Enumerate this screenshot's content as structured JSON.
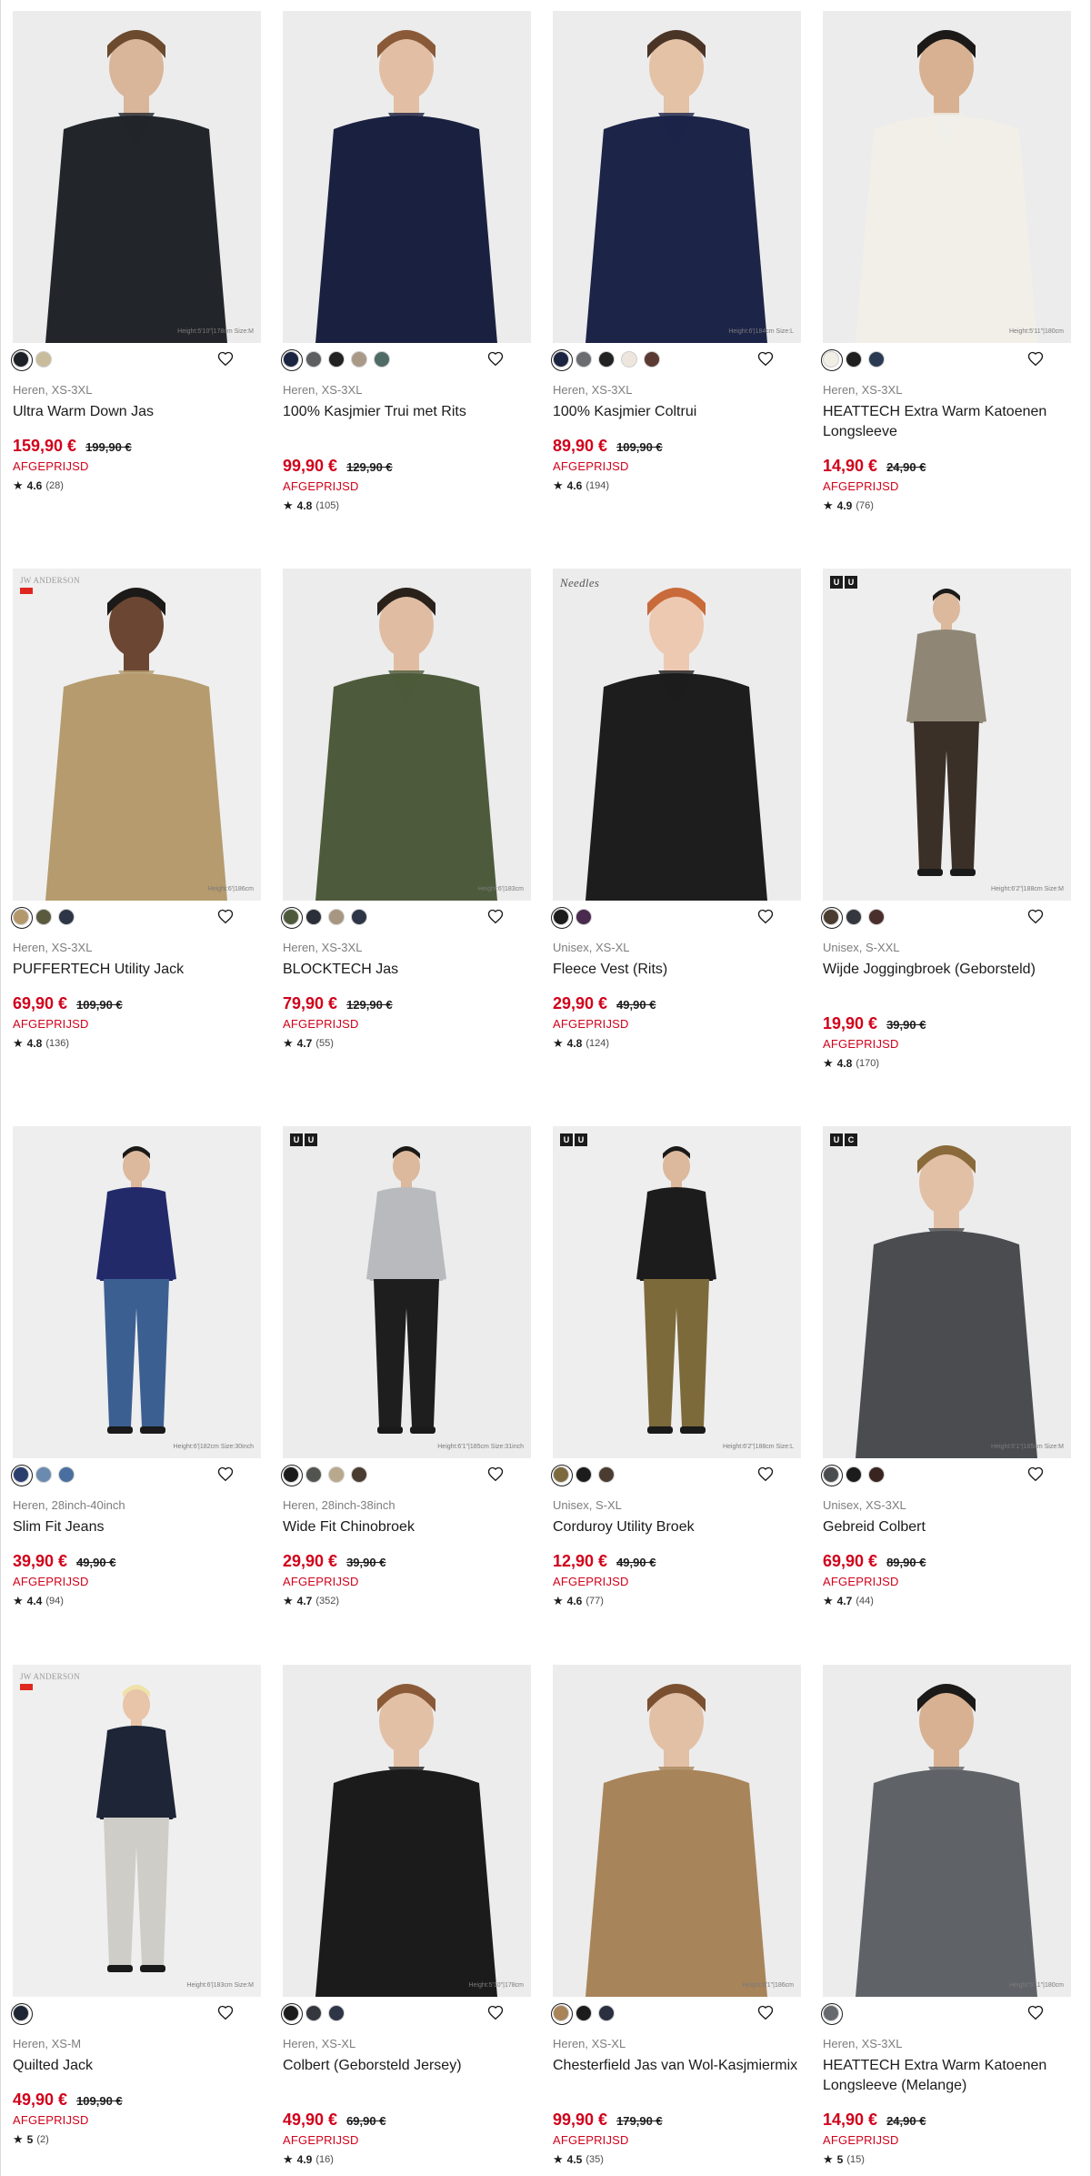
{
  "products": [
    {
      "meta": "Heren, XS-3XL",
      "name": "Ultra Warm Down Jas",
      "price": "159,90 €",
      "old_price": "199,90 €",
      "flag": "AFGEPRIJSD",
      "score": "4.6",
      "count": "(28)",
      "caption": "Height:5'10\"|178cm Size:M",
      "colors": [
        "#1d2127",
        "#c9bc9c"
      ],
      "garment": "#22262a",
      "bg": "#ececec",
      "skin": "#d9b59a",
      "hair": "#6b4a2e",
      "tag": ""
    },
    {
      "meta": "Heren, XS-3XL",
      "name": "100% Kasjmier Trui met Rits",
      "price": "99,90 €",
      "old_price": "129,90 €",
      "flag": "AFGEPRIJSD",
      "score": "4.8",
      "count": "(105)",
      "caption": "",
      "colors": [
        "#1b2440",
        "#5d5f61",
        "#222222",
        "#a99a88",
        "#4f6b66"
      ],
      "garment": "#1a2140",
      "bg": "#ececec",
      "skin": "#e2bfa4",
      "hair": "#8a5a38",
      "tag": ""
    },
    {
      "meta": "Heren, XS-3XL",
      "name": "100% Kasjmier Coltrui",
      "price": "89,90 €",
      "old_price": "109,90 €",
      "flag": "AFGEPRIJSD",
      "score": "4.6",
      "count": "(194)",
      "caption": "Height:6'|184cm Size:L",
      "colors": [
        "#1b2440",
        "#6a6c70",
        "#222222",
        "#eee6dc",
        "#5a3a32"
      ],
      "garment": "#1c2448",
      "bg": "#ececec",
      "skin": "#e4c2a6",
      "hair": "#4a3426",
      "tag": ""
    },
    {
      "meta": "Heren, XS-3XL",
      "name": "HEATTECH Extra Warm Katoenen Longsleeve",
      "price": "14,90 €",
      "old_price": "24,90 €",
      "flag": "AFGEPRIJSD",
      "score": "4.9",
      "count": "(76)",
      "caption": "Height:5'11\"|180cm",
      "colors": [
        "#f1eee6",
        "#1f1f1f",
        "#2a3a52"
      ],
      "garment": "#f1efe8",
      "bg": "#ececec",
      "skin": "#d8b192",
      "hair": "#1c1a18",
      "tag": ""
    },
    {
      "meta": "Heren, XS-3XL",
      "name": "PUFFERTECH Utility Jack",
      "price": "69,90 €",
      "old_price": "109,90 €",
      "flag": "AFGEPRIJSD",
      "score": "4.8",
      "count": "(136)",
      "caption": "Height:6'|186cm",
      "colors": [
        "#b4986c",
        "#5a5b3e",
        "#2d3546"
      ],
      "garment": "#b59b6e",
      "bg": "#efefef",
      "skin": "#6b4632",
      "hair": "#1c1a18",
      "tag": "jw"
    },
    {
      "meta": "Heren, XS-3XL",
      "name": "BLOCKTECH Jas",
      "price": "79,90 €",
      "old_price": "129,90 €",
      "flag": "AFGEPRIJSD",
      "score": "4.7",
      "count": "(55)",
      "caption": "Height:6'|183cm",
      "colors": [
        "#4e5a3c",
        "#2a2f38",
        "#a79680",
        "#2d3546"
      ],
      "garment": "#4d5a3b",
      "bg": "#ececec",
      "skin": "#e0bda2",
      "hair": "#2b211b",
      "tag": ""
    },
    {
      "meta": "Unisex, XS-XL",
      "name": "Fleece Vest (Rits)",
      "price": "29,90 €",
      "old_price": "49,90 €",
      "flag": "AFGEPRIJSD",
      "score": "4.8",
      "count": "(124)",
      "caption": "",
      "colors": [
        "#1c1c1c",
        "#4a2a4e"
      ],
      "garment": "#1d1d1d",
      "bg": "#ececec",
      "skin": "#edc9b2",
      "hair": "#c96a3a",
      "tag": "needles"
    },
    {
      "meta": "Unisex, S-XXL",
      "name": "Wijde Joggingbroek (Geborsteld)",
      "price": "19,90 €",
      "old_price": "39,90 €",
      "flag": "AFGEPRIJSD",
      "score": "4.8",
      "count": "(170)",
      "caption": "Height:6'2\"|188cm Size:M",
      "colors": [
        "#4a3c30",
        "#34383e",
        "#4a2e2c"
      ],
      "garment": "#8f8676",
      "bg": "#eeeeee",
      "skin": "#dcb89c",
      "hair": "#1c1a18",
      "tag": "uu",
      "full": true,
      "pants": "#3a3028"
    },
    {
      "meta": "Heren, 28inch-40inch",
      "name": "Slim Fit Jeans",
      "price": "39,90 €",
      "old_price": "49,90 €",
      "flag": "AFGEPRIJSD",
      "score": "4.4",
      "count": "(94)",
      "caption": "Height:6'|182cm Size:30inch",
      "colors": [
        "#2a3f6e",
        "#6a8ab0",
        "#4b6ea0"
      ],
      "garment": "#232a6a",
      "bg": "#eeeeee",
      "skin": "#dcb89c",
      "hair": "#1c1a18",
      "tag": "",
      "full": true,
      "pants": "#3c5f92"
    },
    {
      "meta": "Heren, 28inch-38inch",
      "name": "Wide Fit Chinobroek",
      "price": "29,90 €",
      "old_price": "39,90 €",
      "flag": "AFGEPRIJSD",
      "score": "4.7",
      "count": "(352)",
      "caption": "Height:6'1\"|185cm Size:31inch",
      "colors": [
        "#1c1c1c",
        "#52544f",
        "#b9a98c",
        "#4a3c30"
      ],
      "garment": "#b8babe",
      "bg": "#ececec",
      "skin": "#dcb89c",
      "hair": "#1c1a18",
      "tag": "uu",
      "full": true,
      "pants": "#1e1e1e"
    },
    {
      "meta": "Unisex, S-XL",
      "name": "Corduroy Utility Broek",
      "price": "12,90 €",
      "old_price": "49,90 €",
      "flag": "AFGEPRIJSD",
      "score": "4.6",
      "count": "(77)",
      "caption": "Height:6'2\"|188cm Size:L",
      "colors": [
        "#7c6a3e",
        "#1c1c1c",
        "#4a3c30"
      ],
      "garment": "#1c1c1c",
      "bg": "#eeeeee",
      "skin": "#dcb89c",
      "hair": "#1c1a18",
      "tag": "uu",
      "full": true,
      "pants": "#7d6a3a"
    },
    {
      "meta": "Unisex, XS-3XL",
      "name": "Gebreid Colbert",
      "price": "69,90 €",
      "old_price": "89,90 €",
      "flag": "AFGEPRIJSD",
      "score": "4.7",
      "count": "(44)",
      "caption": "Height:6'1\"|185cm Size:M",
      "colors": [
        "#4a4c50",
        "#1c1c1c",
        "#3a2420"
      ],
      "garment": "#4a4c50",
      "bg": "#ececec",
      "skin": "#e2c0a6",
      "hair": "#8a6a3a",
      "tag": "uc"
    },
    {
      "meta": "Heren, XS-M",
      "name": "Quilted Jack",
      "price": "49,90 €",
      "old_price": "109,90 €",
      "flag": "AFGEPRIJSD",
      "score": "5",
      "count": "(2)",
      "caption": "Height:6'|183cm Size:M",
      "colors": [
        "#1f2633"
      ],
      "garment": "#1d2536",
      "bg": "#efefef",
      "skin": "#e8c4a8",
      "hair": "#efe2a8",
      "tag": "jw",
      "full": true,
      "pants": "#cfcdc8"
    },
    {
      "meta": "Heren, XS-XL",
      "name": "Colbert (Geborsteld Jersey)",
      "price": "49,90 €",
      "old_price": "69,90 €",
      "flag": "AFGEPRIJSD",
      "score": "4.9",
      "count": "(16)",
      "caption": "Height:5'10\"|178cm",
      "colors": [
        "#1c1c1c",
        "#34383e",
        "#2d3546"
      ],
      "garment": "#1b1b1b",
      "bg": "#ececec",
      "skin": "#e2c0a6",
      "hair": "#8a5a38",
      "tag": ""
    },
    {
      "meta": "Heren, XS-XL",
      "name": "Chesterfield Jas van Wol-Kasjmiermix",
      "price": "99,90 €",
      "old_price": "179,90 €",
      "flag": "AFGEPRIJSD",
      "score": "4.5",
      "count": "(35)",
      "caption": "Height:6'1\"|186cm",
      "colors": [
        "#a88458",
        "#1c1c1c",
        "#2a3040"
      ],
      "garment": "#a8845a",
      "bg": "#ececec",
      "skin": "#e2c0a6",
      "hair": "#7a5030",
      "tag": ""
    },
    {
      "meta": "Heren, XS-3XL",
      "name": "HEATTECH Extra Warm Katoenen Longsleeve (Melange)",
      "price": "14,90 €",
      "old_price": "24,90 €",
      "flag": "AFGEPRIJSD",
      "score": "5",
      "count": "(15)",
      "caption": "Height:5'11\"|180cm",
      "colors": [
        "#66696e"
      ],
      "garment": "#5f6368",
      "bg": "#ececec",
      "skin": "#d8b192",
      "hair": "#1c1a18",
      "tag": ""
    }
  ],
  "brand_tags": {
    "jw": "JW ANDERSON",
    "needles": "Needles",
    "uu_a": "U",
    "uu_b": "U",
    "uc_a": "U",
    "uc_b": "C"
  },
  "icons": {
    "favorite": "heart-outline-icon",
    "rating": "star-icon"
  }
}
